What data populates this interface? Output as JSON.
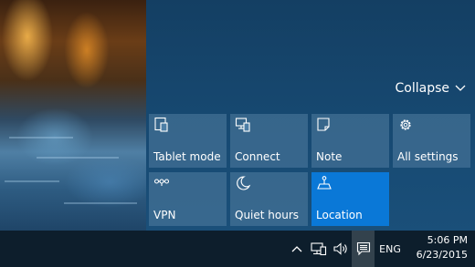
{
  "action_center": {
    "collapse_label": "Collapse",
    "collapse_icon": "chevron-down-icon",
    "tiles": [
      {
        "label": "Tablet mode",
        "icon": "tablet-mode-icon",
        "active": false
      },
      {
        "label": "Connect",
        "icon": "connect-icon",
        "active": false
      },
      {
        "label": "Note",
        "icon": "note-icon",
        "active": false
      },
      {
        "label": "All settings",
        "icon": "gear-icon",
        "active": false
      },
      {
        "label": "VPN",
        "icon": "vpn-icon",
        "active": false
      },
      {
        "label": "Quiet hours",
        "icon": "moon-icon",
        "active": false
      },
      {
        "label": "Location",
        "icon": "location-icon",
        "active": true
      }
    ],
    "colors": {
      "active_tile": "#0a78d7",
      "panel": "#174a73"
    }
  },
  "taskbar": {
    "tray_icons": [
      "chevron-up-icon",
      "network-icon",
      "volume-icon",
      "action-center-icon"
    ],
    "language": "ENG",
    "time": "5:06 PM",
    "date": "6/23/2015",
    "background": "#0d1e2c"
  }
}
